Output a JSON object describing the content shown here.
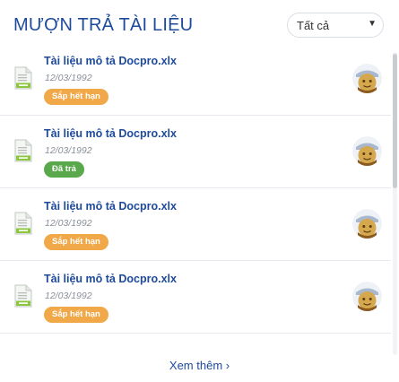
{
  "header": {
    "title": "MƯỢN TRẢ TÀI LIỆU",
    "filter": {
      "selected": "Tất cả"
    }
  },
  "items": [
    {
      "name": "Tài liệu mô tả Docpro.xlx",
      "date": "12/03/1992",
      "status": "Sắp hết hạn",
      "status_color": "#f0a848"
    },
    {
      "name": "Tài liệu mô tả Docpro.xlx",
      "date": "12/03/1992",
      "status": "Đã trả",
      "status_color": "#5aa84c"
    },
    {
      "name": "Tài liệu mô tả Docpro.xlx",
      "date": "12/03/1992",
      "status": "Sắp hết hạn",
      "status_color": "#f0a848"
    },
    {
      "name": "Tài liệu mô tả Docpro.xlx",
      "date": "12/03/1992",
      "status": "Sắp hết hạn",
      "status_color": "#f0a848"
    }
  ],
  "footer": {
    "more_label": "Xem thêm ›"
  },
  "colors": {
    "primary": "#1e4a9c",
    "warning": "#f0a848",
    "success": "#5aa84c"
  }
}
